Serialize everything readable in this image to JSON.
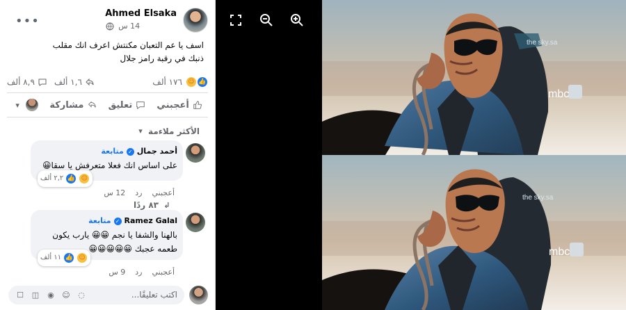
{
  "post": {
    "author": "Ahmed Elsaka",
    "time": "14 س",
    "text_line_1": "اسف يا عم التعبان مكنتش اعرف انك مقلب",
    "text_line_2": "ذنبك في رقبة رامز جلال",
    "reaction_count": "١٧٦ ألف",
    "comment_count": "٨,٩ ألف",
    "share_count": "١,٦ ألف"
  },
  "actions": {
    "like": "أعجبني",
    "comment": "تعليق",
    "share": "مشاركة"
  },
  "comments": {
    "sort": "الأكثر ملاءمة",
    "items": [
      {
        "name": "أحمد جمال",
        "follow": "متابعة",
        "text": "على اساس انك فعلا متعرفش يا سقا😀",
        "reaction_count": "٢,٢ ألف",
        "like": "أعجبني",
        "reply": "رد",
        "time": "12 س",
        "replies": "٨٣ ردًا"
      },
      {
        "name": "Ramez Galal",
        "follow": "متابعة",
        "text": "بالهنا والشفا يا نجم 😀😀 يارب يكون طعمه عجبك 😀😀😀😀😀",
        "reaction_count": "١١ ألف",
        "like": "أعجبني",
        "reply": "رد",
        "time": "9 س"
      }
    ]
  },
  "composer": {
    "placeholder": "اكتب تعليقًا..."
  },
  "viewer": {
    "tools": [
      "expand-icon",
      "zoom-out-icon",
      "zoom-in-icon"
    ],
    "watermark": "mbc",
    "seat_text": "the sky.sa"
  }
}
